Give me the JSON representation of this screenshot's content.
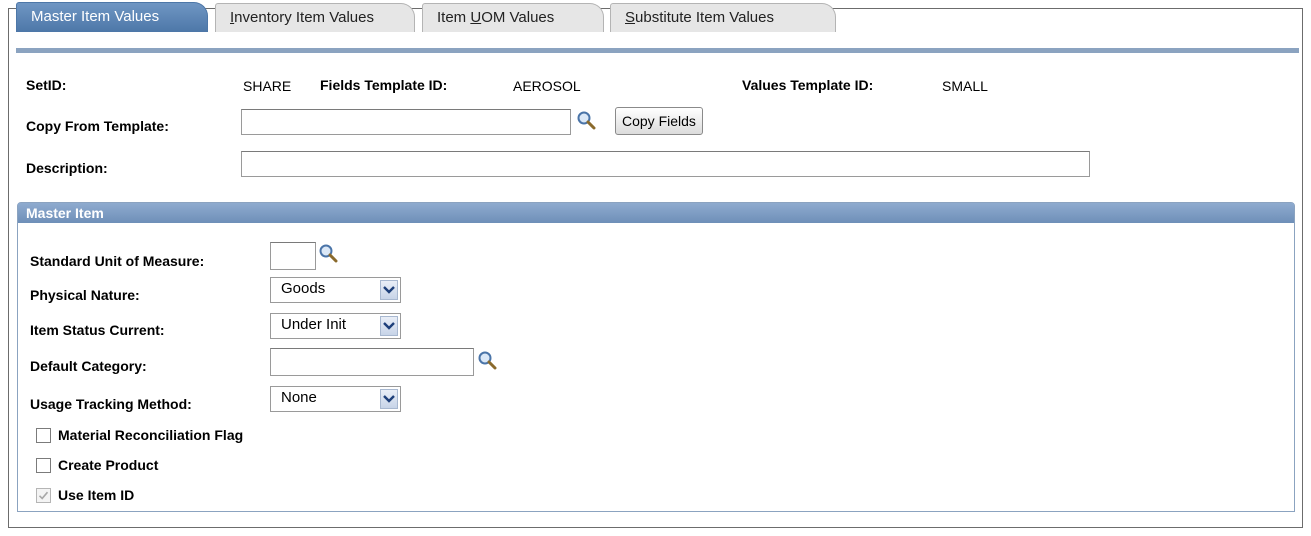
{
  "tabs": [
    {
      "label": "Master Item Values",
      "active": true
    },
    {
      "label_pre": "",
      "label_u": "I",
      "label_post": "nventory Item Values"
    },
    {
      "label_pre": "Item ",
      "label_u": "U",
      "label_post": "OM Values"
    },
    {
      "label_pre": "",
      "label_u": "S",
      "label_post": "ubstitute Item Values"
    }
  ],
  "header": {
    "setid_label": "SetID:",
    "setid_value": "SHARE",
    "fields_template_label": "Fields Template ID:",
    "fields_template_value": "AEROSOL",
    "values_template_label": "Values Template ID:",
    "values_template_value": "SMALL",
    "copy_from_label": "Copy From Template:",
    "copy_from_value": "",
    "copy_fields_button": "Copy Fields",
    "description_label": "Description:",
    "description_value": ""
  },
  "master_item": {
    "title": "Master Item",
    "standard_uom_label": "Standard Unit of Measure:",
    "standard_uom_value": "",
    "physical_nature_label": "Physical Nature:",
    "physical_nature_value": "Goods",
    "item_status_label": "Item Status Current:",
    "item_status_value": "Under Init",
    "default_category_label": "Default Category:",
    "default_category_value": "",
    "usage_tracking_label": "Usage Tracking Method:",
    "usage_tracking_value": "None",
    "checkboxes": [
      {
        "label": "Material Reconciliation Flag",
        "checked": false,
        "disabled": false
      },
      {
        "label": "Create Product",
        "checked": false,
        "disabled": false
      },
      {
        "label": "Use Item ID",
        "checked": true,
        "disabled": true
      }
    ]
  },
  "colors": {
    "tab_active": "#5a82b0",
    "group_header": "#7c9cc4",
    "border": "#8ba3c0"
  }
}
